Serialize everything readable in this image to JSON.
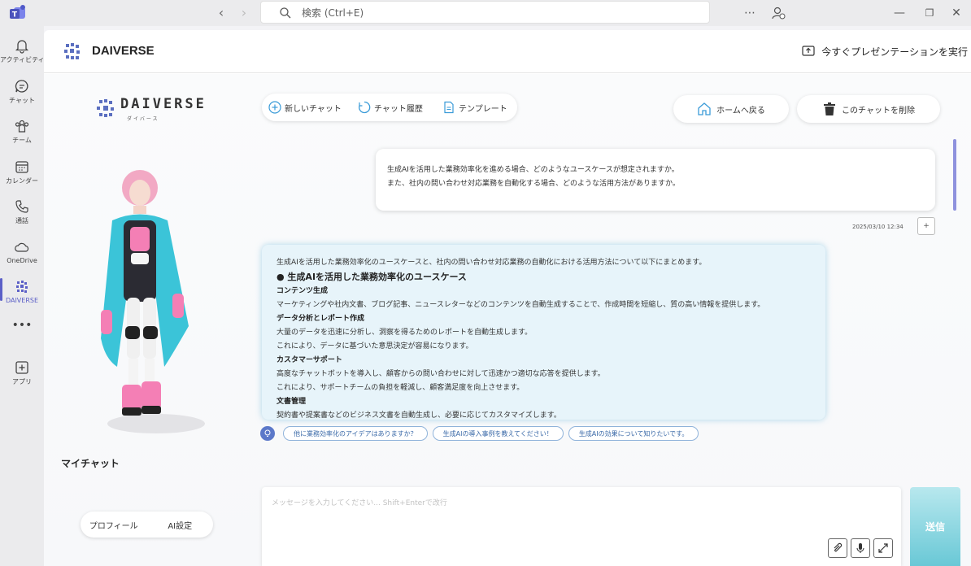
{
  "search": {
    "placeholder": "検索 (Ctrl+E)"
  },
  "rail": {
    "items": [
      {
        "label": "アクティビティ"
      },
      {
        "label": "チャット"
      },
      {
        "label": "チーム"
      },
      {
        "label": "カレンダー"
      },
      {
        "label": "通話"
      },
      {
        "label": "OneDrive"
      },
      {
        "label": "DAIVERSE"
      },
      {
        "label": "アプリ"
      }
    ]
  },
  "app": {
    "name": "DAIVERSE",
    "present_label": "今すぐプレゼンテーションを実行"
  },
  "brand": {
    "name": "DAIVERSE",
    "sub": "ダイバース"
  },
  "toolbar": {
    "new_chat": "新しいチャット",
    "history": "チャット履歴",
    "template": "テンプレート",
    "home": "ホームへ戻る",
    "delete": "このチャットを削除"
  },
  "user_message": {
    "lines": [
      "生成AIを活用した業務効率化を進める場合、どのようなユースケースが想定されますか。",
      "また、社内の問い合わせ対応業務を自動化する場合、どのような活用方法がありますか。"
    ],
    "timestamp": "2025/03/10 12:34",
    "copy_label": "+"
  },
  "ai_message": {
    "intro": "生成AIを活用した業務効率化のユースケースと、社内の問い合わせ対応業務の自動化における活用方法について以下にまとめます。",
    "heading": "● 生成AIを活用した業務効率化のユースケース",
    "sections": [
      {
        "title": "コンテンツ生成",
        "lines": [
          "マーケティングや社内文書、ブログ記事、ニュースレターなどのコンテンツを自動生成することで、作成時間を短縮し、質の高い情報を提供します。"
        ]
      },
      {
        "title": "データ分析とレポート作成",
        "lines": [
          "大量のデータを迅速に分析し、洞察を得るためのレポートを自動生成します。",
          "これにより、データに基づいた意思決定が容易になります。"
        ]
      },
      {
        "title": "カスタマーサポート",
        "lines": [
          "高度なチャットボットを導入し、顧客からの問い合わせに対して迅速かつ適切な応答を提供します。",
          "これにより、サポートチームの負担を軽減し、顧客満足度を向上させます。"
        ]
      },
      {
        "title": "文書管理",
        "lines": [
          "契約書や提案書などのビジネス文書を自動生成し、必要に応じてカスタマイズします。"
        ]
      }
    ]
  },
  "suggestions": [
    "他に業務効率化のアイデアはありますか？",
    "生成AIの導入事例を教えてください！",
    "生成AIの効果について知りたいです。"
  ],
  "left_panel": {
    "my_chat": "マイチャット",
    "profile_tab": "プロフィール",
    "ai_settings_tab": "AI設定"
  },
  "input": {
    "placeholder": "メッセージを入力してください... Shift+Enterで改行",
    "send_label": "送信"
  },
  "colors": {
    "accent": "#5b5fc7",
    "send": "#69c8d6",
    "ai_bubble": "#e7f4fa"
  }
}
